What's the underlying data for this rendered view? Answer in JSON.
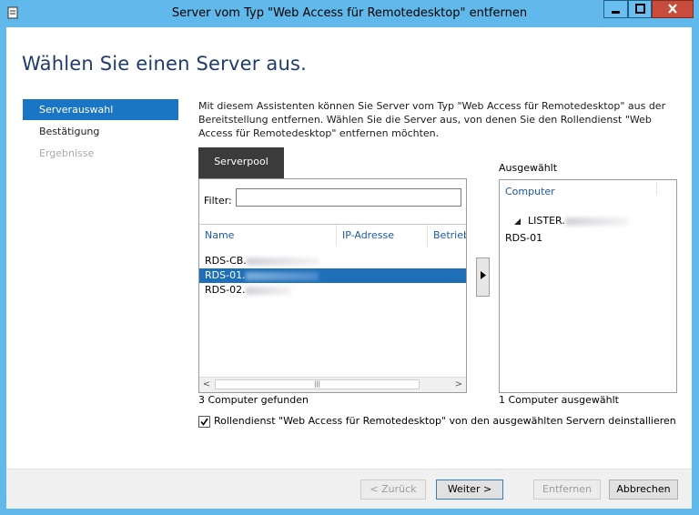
{
  "window": {
    "title": "Server vom Typ \"Web Access für Remotedesktop\" entfernen"
  },
  "page": {
    "heading": "Wählen Sie einen Server aus.",
    "description": "Mit diesem Assistenten können Sie Server vom Typ \"Web Access für Remotedesktop\" aus der Bereitstellung entfernen. Wählen Sie die Server aus, von denen Sie den Rollendienst \"Web Access für Remotedesktop\" entfernen möchten."
  },
  "nav": {
    "items": [
      {
        "label": "Serverauswahl",
        "state": "active"
      },
      {
        "label": "Bestätigung",
        "state": "normal"
      },
      {
        "label": "Ergebnisse",
        "state": "disabled"
      }
    ]
  },
  "serverpool": {
    "tab_label": "Serverpool",
    "filter_label": "Filter:",
    "filter_value": "",
    "columns": [
      "Name",
      "IP-Adresse",
      "Betrieb"
    ],
    "rows": [
      {
        "name": "RDS-CB.",
        "selected": false
      },
      {
        "name": "RDS-01.",
        "selected": true
      },
      {
        "name": "RDS-02.",
        "selected": false
      }
    ],
    "count_text": "3 Computer gefunden"
  },
  "selected": {
    "label": "Ausgewählt",
    "column": "Computer",
    "group_name": "LISTER.",
    "items": [
      "RDS-01"
    ],
    "count_text": "1 Computer ausgewählt"
  },
  "option": {
    "checked": true,
    "label": "Rollendienst \"Web Access für Remotedesktop\" von den ausgewählten Servern deinstallieren"
  },
  "buttons": {
    "back": "< Zurück",
    "next": "Weiter >",
    "remove": "Entfernen",
    "cancel": "Abbrechen"
  },
  "colors": {
    "titlebar": "#61b8ea",
    "accent": "#1a75c4",
    "heading": "#1e3b6f",
    "close": "#c74c3c"
  }
}
